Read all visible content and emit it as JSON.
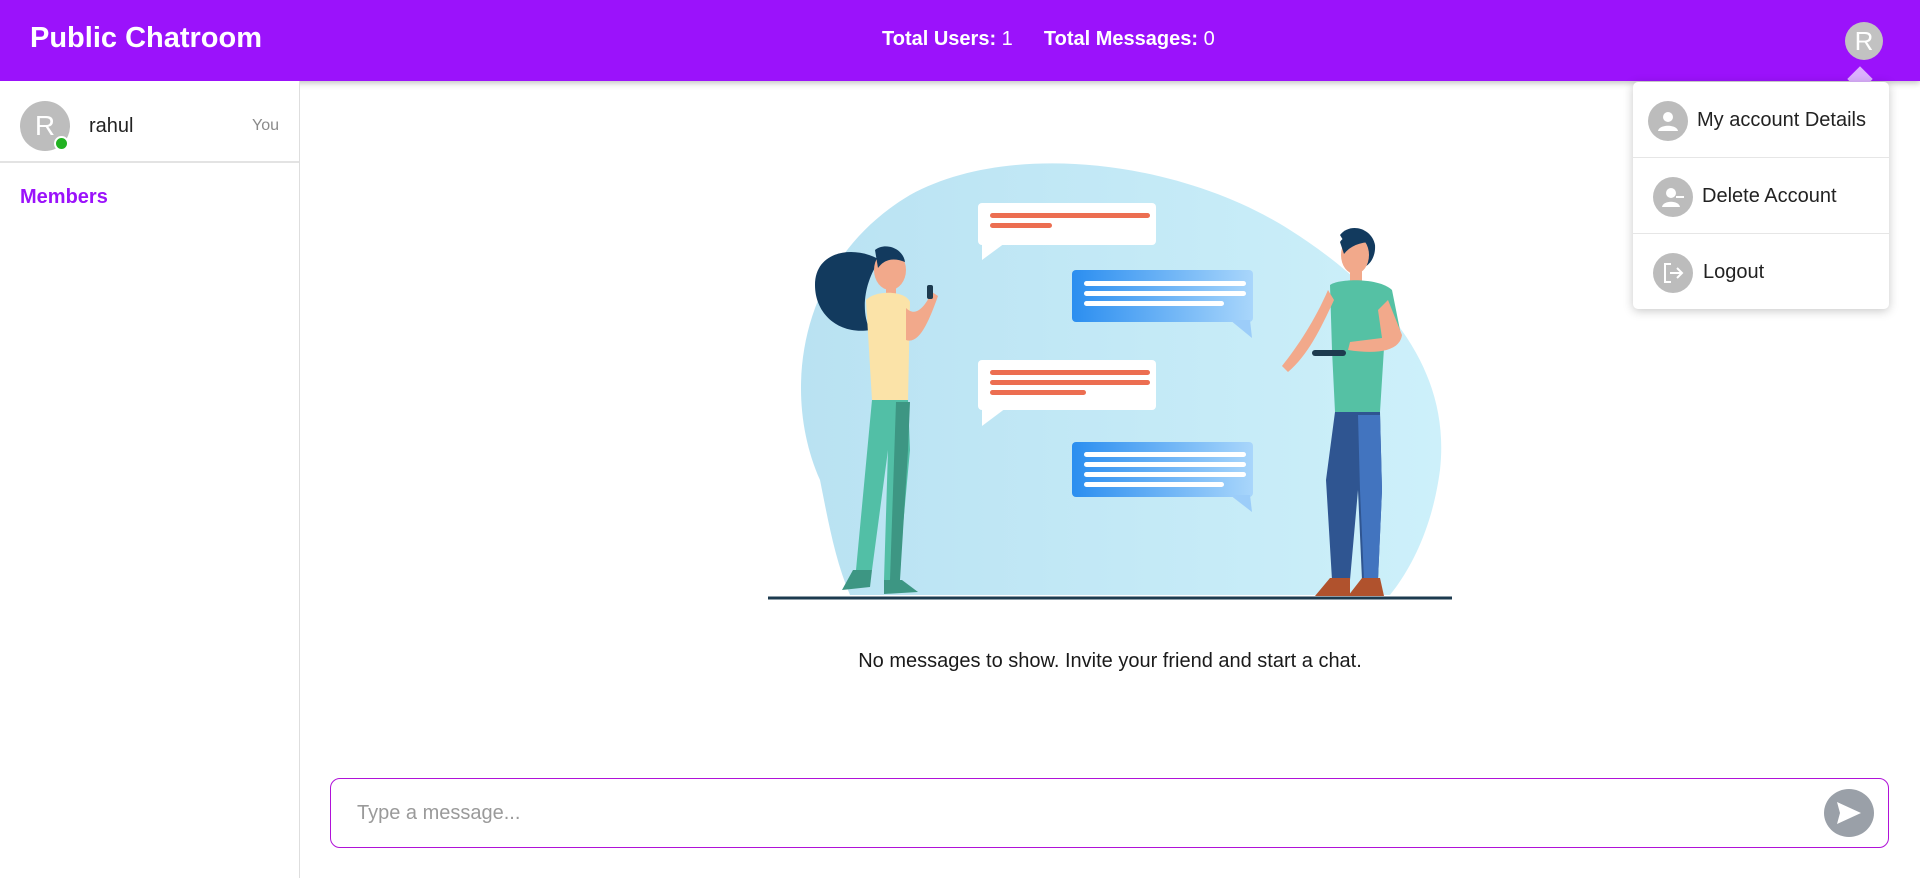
{
  "header": {
    "title": "Public Chatroom",
    "users_label": "Total Users:",
    "users_value": "1",
    "messages_label": "Total Messages:",
    "messages_value": "0",
    "avatar_letter": "R"
  },
  "sidebar": {
    "current_user": {
      "avatar_letter": "R",
      "name": "rahul",
      "tag": "You",
      "status": "online"
    },
    "members_title": "Members"
  },
  "main": {
    "empty_message": "No messages to show. Invite your friend and start a chat.",
    "composer": {
      "placeholder": "Type a message..."
    }
  },
  "user_menu": {
    "items": [
      {
        "label": "My account Details",
        "icon": "user-icon"
      },
      {
        "label": "Delete Account",
        "icon": "user-minus-icon"
      },
      {
        "label": "Logout",
        "icon": "logout-icon"
      }
    ]
  },
  "colors": {
    "brand": "#9b12fb",
    "online": "#22b222",
    "send_button": "#9aa0a8"
  }
}
